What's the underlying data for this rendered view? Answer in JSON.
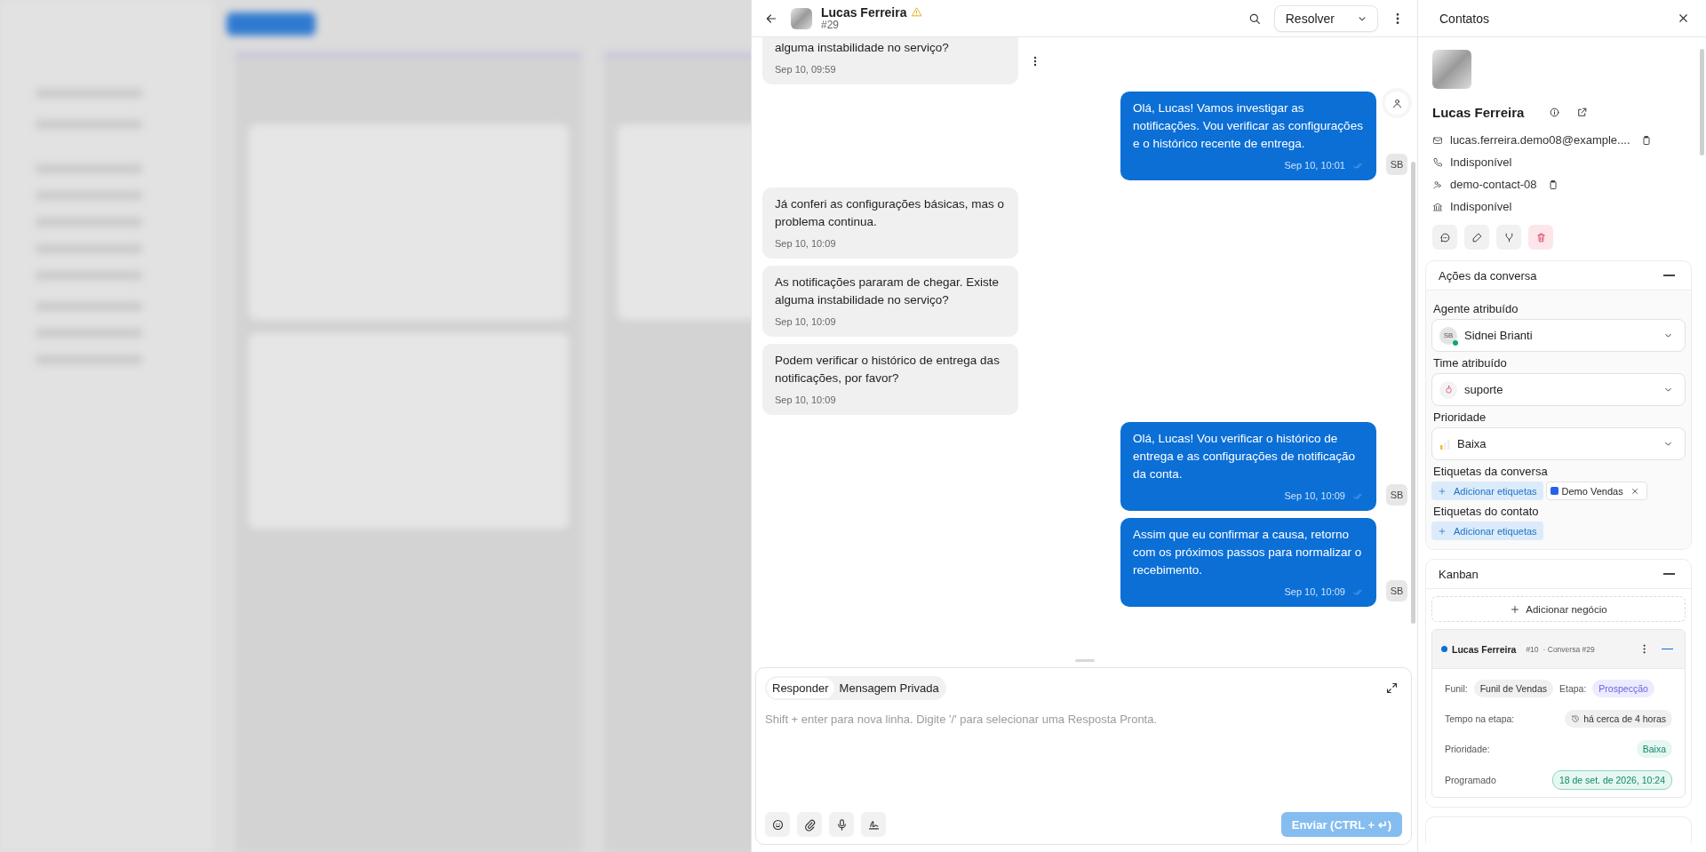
{
  "conversation": {
    "contact_name": "Lucas Ferreira",
    "number": "#29",
    "resolve_button": "Resolver"
  },
  "messages": [
    {
      "kind": "incoming",
      "text": "alguma instabilidade no serviço?",
      "time": "Sep 10, 09:59",
      "menu": true
    },
    {
      "kind": "outgoing",
      "text": "Olá, Lucas! Vamos investigar as notificações. Vou verificar as configurações e o histórico recente de entrega.",
      "time": "Sep 10, 10:01",
      "avatar": "SB",
      "contact_icon": true
    },
    {
      "kind": "incoming",
      "text": "Já conferi as configurações básicas, mas o problema continua.",
      "time": "Sep 10, 10:09"
    },
    {
      "kind": "incoming",
      "text": "As notificações pararam de chegar. Existe alguma instabilidade no serviço?",
      "time": "Sep 10, 10:09"
    },
    {
      "kind": "incoming",
      "text": "Podem verificar o histórico de entrega das notificações, por favor?",
      "time": "Sep 10, 10:09"
    },
    {
      "kind": "outgoing",
      "text": "Olá, Lucas! Vou verificar o histórico de entrega e as configurações de notificação da conta.",
      "time": "Sep 10, 10:09",
      "avatar": "SB"
    },
    {
      "kind": "outgoing",
      "text": "Assim que eu confirmar a causa, retorno com os próximos passos para normalizar o recebimento.",
      "time": "Sep 10, 10:09",
      "avatar": "SB"
    }
  ],
  "composer": {
    "tabs": [
      {
        "label": "Responder",
        "selected": true
      },
      {
        "label": "Mensagem Privada",
        "selected": false
      }
    ],
    "placeholder": "Shift + enter para nova linha. Digite '/' para selecionar uma Resposta Pronta.",
    "send_button": "Enviar (CTRL + ↵)",
    "send_disabled": true
  },
  "contact_panel": {
    "title": "Contatos",
    "name": "Lucas Ferreira",
    "details": [
      {
        "kind": "email",
        "text": "lucas.ferreira.demo08@example....",
        "copy": true
      },
      {
        "kind": "phone",
        "text": "Indisponível",
        "copy": false
      },
      {
        "kind": "id",
        "text": "demo-contact-08",
        "copy": true
      },
      {
        "kind": "company",
        "text": "Indisponível",
        "copy": false
      }
    ]
  },
  "conversation_actions": {
    "title": "Ações da conversa",
    "agent": {
      "label": "Agente atribuído",
      "initials": "SB",
      "value": "Sidnei Brianti",
      "online": true
    },
    "team": {
      "label": "Time atribuído",
      "value": "suporte"
    },
    "priority": {
      "label": "Prioridade",
      "value": "Baixa"
    },
    "conversation_labels": {
      "label": "Etiquetas da conversa",
      "add": "Adicionar etiquetas",
      "tags": [
        {
          "text": "Demo Vendas",
          "color": "#2563eb"
        }
      ]
    },
    "contact_labels": {
      "label": "Etiquetas do contato",
      "add": "Adicionar etiquetas"
    }
  },
  "kanban": {
    "title": "Kanban",
    "add_deal": "Adicionar negócio",
    "deal": {
      "name": "Lucas Ferreira",
      "number": "#10",
      "conversation": "· Conversa #29",
      "funnel_label": "Funil:",
      "funnel": "Funil de Vendas",
      "stage_label": "Etapa:",
      "stage": "Prospecção",
      "time_label": "Tempo na etapa:",
      "time": "há cerca de 4 horas",
      "priority_label": "Prioridade:",
      "priority": "Baixa",
      "scheduled_label": "Programado",
      "scheduled": "18 de set. de 2026, 10:24"
    }
  }
}
